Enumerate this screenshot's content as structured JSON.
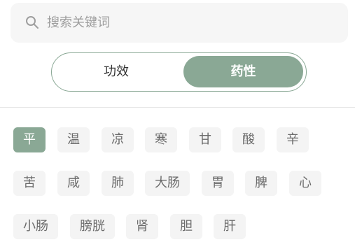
{
  "search": {
    "placeholder": "搜索关键词"
  },
  "toggle": {
    "left_label": "功效",
    "right_label": "药性",
    "selected": "药性"
  },
  "tags": {
    "row1": [
      "平",
      "温",
      "凉",
      "寒",
      "甘",
      "酸",
      "辛"
    ],
    "row2": [
      "苦",
      "咸",
      "肺",
      "大肠",
      "胃",
      "脾",
      "心"
    ],
    "row3": [
      "小肠",
      "膀胱",
      "肾",
      "胆",
      "肝"
    ]
  },
  "active_tag": "平",
  "colors": {
    "accent": "#8aa895",
    "tag_bg": "#f4f4f4",
    "search_bg": "#f6f6f6"
  }
}
